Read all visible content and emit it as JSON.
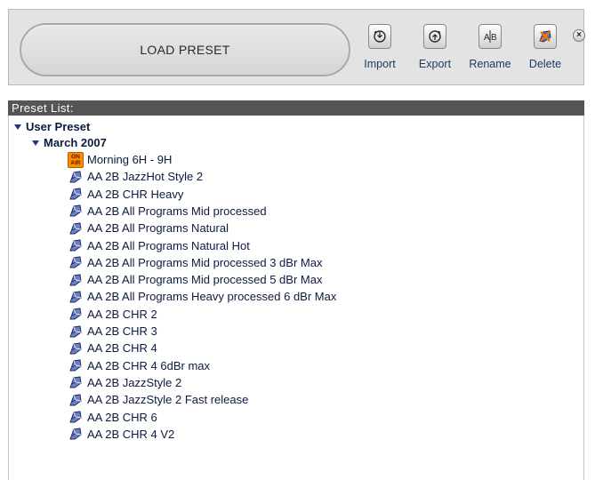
{
  "toolbar": {
    "load_preset_label": "LOAD PRESET",
    "buttons": {
      "import": {
        "label": "Import",
        "icon": "import-icon"
      },
      "export": {
        "label": "Export",
        "icon": "export-icon"
      },
      "rename": {
        "label": "Rename",
        "icon": "rename-icon"
      },
      "delete": {
        "label": "Delete",
        "icon": "delete-icon"
      }
    },
    "close_glyph": "×"
  },
  "list": {
    "header": "Preset List:",
    "root_label": "User Preset",
    "folder_label": "March 2007",
    "items": [
      {
        "label": "Morning 6H - 9H",
        "icon": "on-air-icon",
        "badge_top": "ON",
        "badge_bottom": "AIR"
      },
      {
        "label": "AA 2B JazzHot Style 2",
        "icon": "preset-icon"
      },
      {
        "label": "AA 2B CHR Heavy",
        "icon": "preset-icon"
      },
      {
        "label": "AA 2B All Programs Mid processed",
        "icon": "preset-icon"
      },
      {
        "label": "AA 2B All Programs Natural",
        "icon": "preset-icon"
      },
      {
        "label": "AA 2B All Programs Natural Hot",
        "icon": "preset-icon"
      },
      {
        "label": "AA 2B All Programs Mid processed 3 dBr Max",
        "icon": "preset-icon"
      },
      {
        "label": "AA 2B All Programs Mid processed 5 dBr Max",
        "icon": "preset-icon"
      },
      {
        "label": "AA 2B All Programs Heavy processed 6 dBr Max",
        "icon": "preset-icon"
      },
      {
        "label": "AA 2B CHR 2",
        "icon": "preset-icon"
      },
      {
        "label": "AA 2B CHR 3",
        "icon": "preset-icon"
      },
      {
        "label": "AA 2B CHR 4",
        "icon": "preset-icon"
      },
      {
        "label": "AA 2B CHR 4 6dBr max",
        "icon": "preset-icon"
      },
      {
        "label": "AA 2B JazzStyle 2",
        "icon": "preset-icon"
      },
      {
        "label": "AA 2B JazzStyle 2 Fast release",
        "icon": "preset-icon"
      },
      {
        "label": "AA 2B CHR 6",
        "icon": "preset-icon"
      },
      {
        "label": "AA 2B CHR 4 V2",
        "icon": "preset-icon"
      }
    ]
  },
  "colors": {
    "header_bg": "#555555",
    "text": "#0d1a40",
    "toolbar_bg": "#e3e3e3",
    "on_air": "#ff8a00"
  }
}
